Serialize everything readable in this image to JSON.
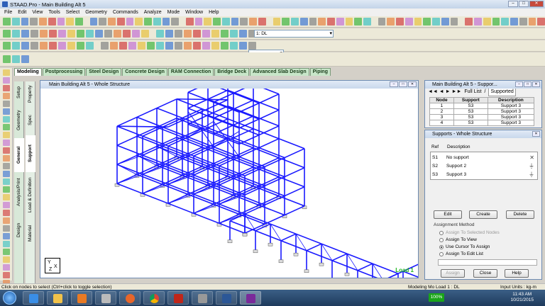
{
  "window": {
    "title": "STAAD.Pro - Main Building Alt 5"
  },
  "menu": [
    "File",
    "Edit",
    "View",
    "Tools",
    "Select",
    "Geometry",
    "Commands",
    "Analyze",
    "Mode",
    "Window",
    "Help"
  ],
  "toolbar": {
    "load_combo": "1: DL"
  },
  "page_tabs": [
    "Modeling",
    "Postprocessing",
    "Steel Design",
    "Concrete Design",
    "RAM Connection",
    "Bridge Deck",
    "Advanced Slab Design",
    "Piping"
  ],
  "side_tabs_outer": [
    "Setup",
    "Geometry",
    "General",
    "Analysis/Print",
    "Design"
  ],
  "side_tabs_inner": [
    "Property",
    "Spec",
    "Support",
    "Load & Definition",
    "Material"
  ],
  "view": {
    "title": "Main Building Alt 5 - Whole Structure",
    "load_label": "Load 1",
    "axis_y": "Y",
    "axis_x": "X",
    "axis_z": "Z"
  },
  "support_table": {
    "title": "Main Building Alt 5 - Suppor...",
    "nav_full": "Full List",
    "nav_supported": "Supported",
    "headers": [
      "Node",
      "Support",
      "Description"
    ],
    "rows": [
      [
        "1",
        "S3",
        "Support 3"
      ],
      [
        "2",
        "S3",
        "Support 3"
      ],
      [
        "3",
        "S3",
        "Support 3"
      ],
      [
        "4",
        "S3",
        "Support 3"
      ]
    ]
  },
  "supports_panel": {
    "title": "Supports - Whole Structure",
    "col_ref": "Ref",
    "col_desc": "Description",
    "items": [
      {
        "ref": "S1",
        "desc": "No support"
      },
      {
        "ref": "S2",
        "desc": "Support 2"
      },
      {
        "ref": "S3",
        "desc": "Support 3"
      }
    ],
    "edit": "Edit",
    "create": "Create",
    "delete": "Delete",
    "assignment_method": "Assignment Method",
    "options": [
      "Assign To Selected Nodes",
      "Assign To View",
      "Use Cursor To Assign",
      "Assign To Edit List"
    ],
    "assign": "Assign",
    "close": "Close",
    "help": "Help"
  },
  "status": {
    "left": "Click on nodes to select (Ctrl+click to toggle selection)",
    "mid": "Modeling Mo  Load 1 : DL",
    "right": "Input Units : kg-m"
  },
  "taskbar": {
    "zoom": "100%",
    "time": "11:43 AM",
    "date": "10/21/2015"
  },
  "colors": {
    "structure": "#1a1aff",
    "load_label": "#1fb81f",
    "tab_bg": "#c8e6c9"
  }
}
